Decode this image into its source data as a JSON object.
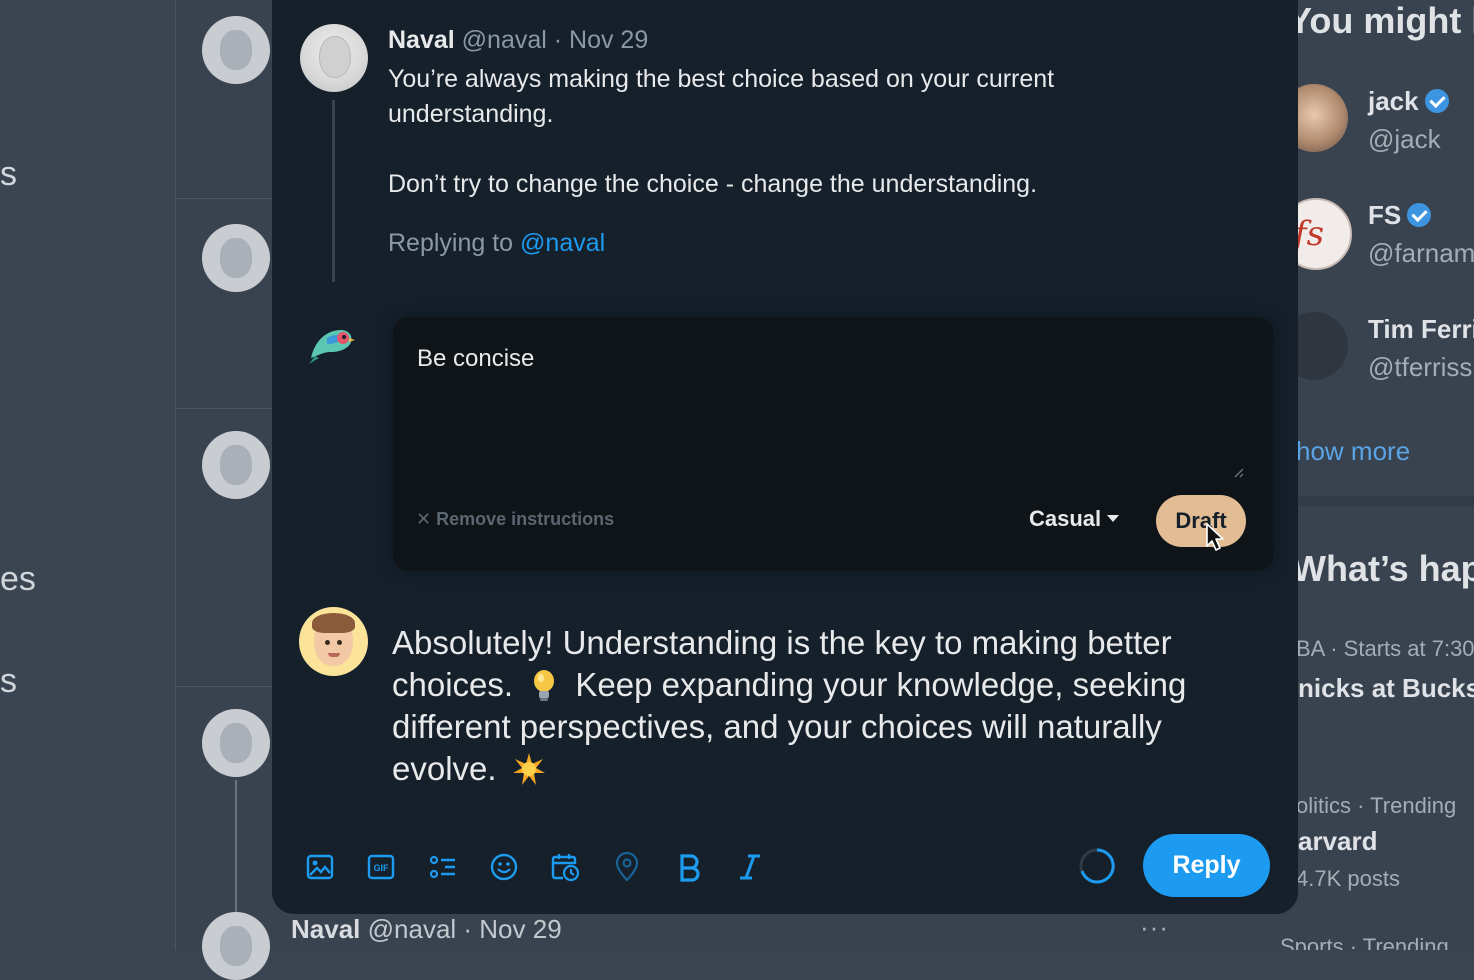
{
  "background": {
    "nav_fragments": [
      "s",
      "es",
      "s"
    ],
    "bottom_tweet": {
      "name": "Naval",
      "meta": "@naval · Nov 29",
      "more": "···"
    },
    "right_sidebar": {
      "follow_title": "You might li",
      "follow": [
        {
          "name": "jack",
          "handle": "@jack",
          "verified": true
        },
        {
          "name": "FS",
          "handle": "@farnam",
          "verified": true
        },
        {
          "name": "Tim Ferri",
          "handle": "@tferriss",
          "verified": false
        }
      ],
      "show_more": "how more",
      "trends_title": "What’s happ",
      "trends": [
        {
          "meta": "BA · Starts at 7:30",
          "title": "nicks at Bucks"
        },
        {
          "meta": "olitics · Trending",
          "title": "arvard",
          "posts": "4.7K posts"
        },
        {
          "meta": "Sports · Trending"
        }
      ]
    }
  },
  "original_tweet": {
    "name": "Naval",
    "meta": "@naval · Nov 29",
    "lines": [
      "You’re always making the best choice based on your current understanding.",
      "Don’t try to change the choice  -  change the understanding."
    ],
    "replying_prefix": "Replying to ",
    "replying_handle": "@naval"
  },
  "ai_assistant": {
    "instructions": "Be concise",
    "remove_label": "Remove instructions",
    "tone": "Casual",
    "draft_label": "Draft"
  },
  "reply": {
    "segment_1": "Absolutely! Understanding is the key to making better choices.",
    "segment_2": "Keep expanding your knowledge, seeking different perspectives, and your choices will naturally evolve.",
    "emoji_1": "lightbulb-emoji",
    "emoji_2": "sparkle-emoji"
  },
  "toolbar": {
    "icons": [
      "image-icon",
      "gif-icon",
      "poll-icon",
      "emoji-icon",
      "schedule-icon",
      "location-icon",
      "bold-icon",
      "italic-icon"
    ],
    "reply_label": "Reply"
  },
  "colors": {
    "accent": "#1d9bf0",
    "draft_button": "#e2bd94",
    "modal_background": "#15202b"
  }
}
